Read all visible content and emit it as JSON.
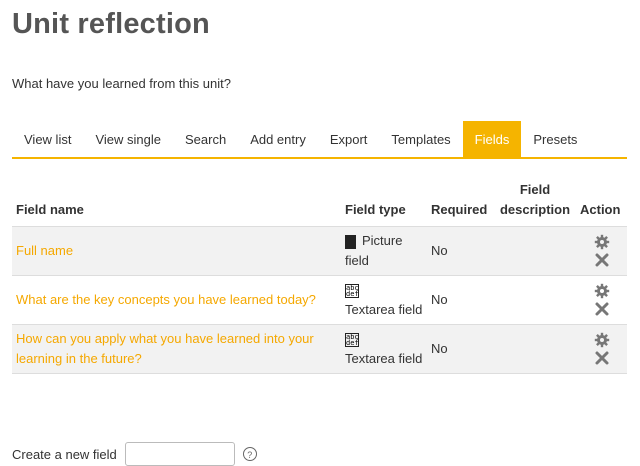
{
  "page": {
    "title": "Unit reflection",
    "intro": "What have you learned from this unit?"
  },
  "tabs": [
    {
      "label": "View list",
      "active": false
    },
    {
      "label": "View single",
      "active": false
    },
    {
      "label": "Search",
      "active": false
    },
    {
      "label": "Add entry",
      "active": false
    },
    {
      "label": "Export",
      "active": false
    },
    {
      "label": "Templates",
      "active": false
    },
    {
      "label": "Fields",
      "active": true
    },
    {
      "label": "Presets",
      "active": false
    }
  ],
  "table": {
    "headers": {
      "name": "Field name",
      "type": "Field type",
      "required": "Required",
      "description": "Field description",
      "action": "Action"
    },
    "rows": [
      {
        "name": "Full name",
        "type": "Picture field",
        "icon": "picture-field-icon",
        "required": "No",
        "description": ""
      },
      {
        "name": "What are the key concepts you have learned today?",
        "type": "Textarea field",
        "icon": "textarea-field-icon",
        "required": "No",
        "description": ""
      },
      {
        "name": "How can you apply what you have learned into your learning in the future?",
        "type": "Textarea field",
        "icon": "textarea-field-icon",
        "required": "No",
        "description": ""
      }
    ]
  },
  "bottom": {
    "label": "Create a new field"
  },
  "colors": {
    "accent": "#f5b400",
    "link": "#f5a800",
    "title": "#555555"
  }
}
